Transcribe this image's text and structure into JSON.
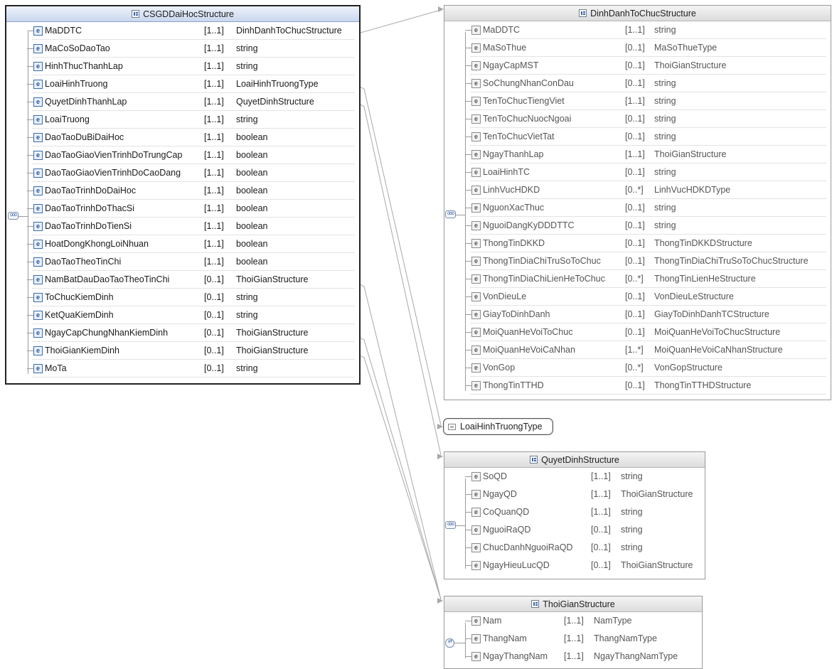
{
  "structures": [
    {
      "id": "csgd",
      "title": "CSGDDaiHocStructure",
      "elements": [
        {
          "name": "MaDDTC",
          "card": "[1..1]",
          "type": "DinhDanhToChucStructure"
        },
        {
          "name": "MaCoSoDaoTao",
          "card": "[1..1]",
          "type": "string"
        },
        {
          "name": "HinhThucThanhLap",
          "card": "[1..1]",
          "type": "string"
        },
        {
          "name": "LoaiHinhTruong",
          "card": "[1..1]",
          "type": "LoaiHinhTruongType"
        },
        {
          "name": "QuyetDinhThanhLap",
          "card": "[1..1]",
          "type": "QuyetDinhStructure"
        },
        {
          "name": "LoaiTruong",
          "card": "[1..1]",
          "type": "string"
        },
        {
          "name": "DaoTaoDuBiDaiHoc",
          "card": "[1..1]",
          "type": "boolean"
        },
        {
          "name": "DaoTaoGiaoVienTrinhDoTrungCap",
          "card": "[1..1]",
          "type": "boolean"
        },
        {
          "name": "DaoTaoGiaoVienTrinhDoCaoDang",
          "card": "[1..1]",
          "type": "boolean"
        },
        {
          "name": "DaoTaoTrinhDoDaiHoc",
          "card": "[1..1]",
          "type": "boolean"
        },
        {
          "name": "DaoTaoTrinhDoThacSi",
          "card": "[1..1]",
          "type": "boolean"
        },
        {
          "name": "DaoTaoTrinhDoTienSi",
          "card": "[1..1]",
          "type": "boolean"
        },
        {
          "name": "HoatDongKhongLoiNhuan",
          "card": "[1..1]",
          "type": "boolean"
        },
        {
          "name": "DaoTaoTheoTinChi",
          "card": "[1..1]",
          "type": "boolean"
        },
        {
          "name": "NamBatDauDaoTaoTheoTinChi",
          "card": "[0..1]",
          "type": "ThoiGianStructure"
        },
        {
          "name": "ToChucKiemDinh",
          "card": "[0..1]",
          "type": "string"
        },
        {
          "name": "KetQuaKiemDinh",
          "card": "[0..1]",
          "type": "string"
        },
        {
          "name": "NgayCapChungNhanKiemDinh",
          "card": "[0..1]",
          "type": "ThoiGianStructure"
        },
        {
          "name": "ThoiGianKiemDinh",
          "card": "[0..1]",
          "type": "ThoiGianStructure"
        },
        {
          "name": "MoTa",
          "card": "[0..1]",
          "type": "string"
        }
      ]
    },
    {
      "id": "dinhdanh",
      "title": "DinhDanhToChucStructure",
      "elements": [
        {
          "name": "MaDDTC",
          "card": "[1..1]",
          "type": "string"
        },
        {
          "name": "MaSoThue",
          "card": "[0..1]",
          "type": "MaSoThueType"
        },
        {
          "name": "NgayCapMST",
          "card": "[0..1]",
          "type": "ThoiGianStructure"
        },
        {
          "name": "SoChungNhanConDau",
          "card": "[0..1]",
          "type": "string"
        },
        {
          "name": "TenToChucTiengViet",
          "card": "[1..1]",
          "type": "string"
        },
        {
          "name": "TenToChucNuocNgoai",
          "card": "[0..1]",
          "type": "string"
        },
        {
          "name": "TenToChucVietTat",
          "card": "[0..1]",
          "type": "string"
        },
        {
          "name": "NgayThanhLap",
          "card": "[1..1]",
          "type": "ThoiGianStructure"
        },
        {
          "name": "LoaiHinhTC",
          "card": "[0..1]",
          "type": "string"
        },
        {
          "name": "LinhVucHDKD",
          "card": "[0..*]",
          "type": "LinhVucHDKDType"
        },
        {
          "name": "NguonXacThuc",
          "card": "[0..1]",
          "type": "string"
        },
        {
          "name": "NguoiDangKyDDDTTC",
          "card": "[0..1]",
          "type": "string"
        },
        {
          "name": "ThongTinDKKD",
          "card": "[0..1]",
          "type": "ThongTinDKKDStructure"
        },
        {
          "name": "ThongTinDiaChiTruSoToChuc",
          "card": "[0..1]",
          "type": "ThongTinDiaChiTruSoToChucStructure"
        },
        {
          "name": "ThongTinDiaChiLienHeToChuc",
          "card": "[0..*]",
          "type": "ThongTinLienHeStructure"
        },
        {
          "name": "VonDieuLe",
          "card": "[0..1]",
          "type": "VonDieuLeStructure"
        },
        {
          "name": "GiayToDinhDanh",
          "card": "[0..1]",
          "type": "GiayToDinhDanhTCStructure"
        },
        {
          "name": "MoiQuanHeVoiToChuc",
          "card": "[0..1]",
          "type": "MoiQuanHeVoiToChucStructure"
        },
        {
          "name": "MoiQuanHeVoiCaNhan",
          "card": "[1..*]",
          "type": "MoiQuanHeVoiCaNhanStructure"
        },
        {
          "name": "VonGop",
          "card": "[0..*]",
          "type": "VonGopStructure"
        },
        {
          "name": "ThongTinTTHD",
          "card": "[0..1]",
          "type": "ThongTinTTHDStructure"
        }
      ]
    },
    {
      "id": "quyetdinh",
      "title": "QuyetDinhStructure",
      "elements": [
        {
          "name": "SoQD",
          "card": "[1..1]",
          "type": "string"
        },
        {
          "name": "NgayQD",
          "card": "[1..1]",
          "type": "ThoiGianStructure"
        },
        {
          "name": "CoQuanQD",
          "card": "[1..1]",
          "type": "string"
        },
        {
          "name": "NguoiRaQD",
          "card": "[0..1]",
          "type": "string"
        },
        {
          "name": "ChucDanhNguoiRaQD",
          "card": "[0..1]",
          "type": "string"
        },
        {
          "name": "NgayHieuLucQD",
          "card": "[0..1]",
          "type": "ThoiGianStructure"
        }
      ]
    },
    {
      "id": "thoigian",
      "title": "ThoiGianStructure",
      "elements": [
        {
          "name": "Nam",
          "card": "[1..1]",
          "type": "NamType"
        },
        {
          "name": "ThangNam",
          "card": "[1..1]",
          "type": "ThangNamType"
        },
        {
          "name": "NgayThangNam",
          "card": "[1..1]",
          "type": "NgayThangNamType"
        }
      ]
    }
  ],
  "simple_type": {
    "title": "LoaiHinhTruongType"
  },
  "element_badge": "e",
  "sequence_badge": "ooo",
  "colors": {
    "main_border": "#222222",
    "ref_border": "#9a9a9a",
    "badge_blue": "#3a6ab0",
    "connector": "#a8a8a8"
  }
}
